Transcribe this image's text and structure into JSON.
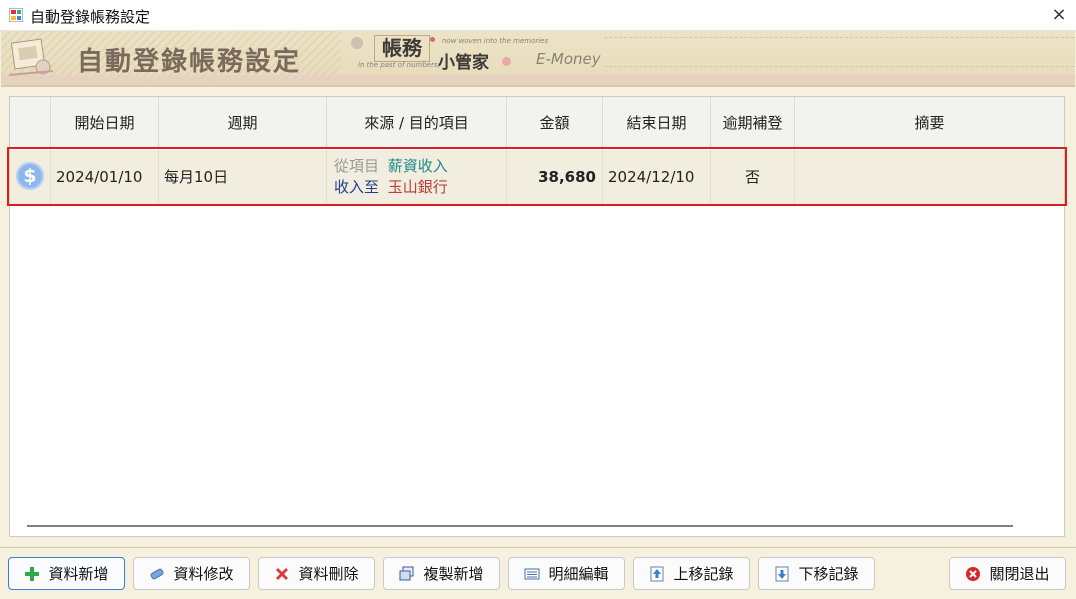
{
  "window": {
    "title": "自動登錄帳務設定",
    "close_glyph": "×"
  },
  "banner": {
    "title": "自動登錄帳務設定",
    "logo_text": "帳務",
    "tagline_top": "now woven into the memories",
    "tagline_bottom": "in the past of numbers,",
    "subtitle": "小管家",
    "brand": "E-Money"
  },
  "table": {
    "columns": [
      "開始日期",
      "週期",
      "來源 / 目的項目",
      "金額",
      "結束日期",
      "逾期補登",
      "摘要"
    ],
    "rows": [
      {
        "icon": "dollar-icon",
        "start_date": "2024/01/10",
        "period": "每月10日",
        "from_label": "從項目",
        "from_value": "薪資收入",
        "to_label": "收入至",
        "to_value": "玉山銀行",
        "amount": "38,680",
        "end_date": "2024/12/10",
        "overdue": "否",
        "summary": ""
      }
    ]
  },
  "colors": {
    "from_value": "#1f8a8a",
    "to_label": "#1f3f8a",
    "to_value": "#b84040",
    "highlight": "#d92020"
  },
  "buttons": {
    "add": "資料新增",
    "edit": "資料修改",
    "delete": "資料刪除",
    "copy_add": "複製新增",
    "detail_edit": "明細編輯",
    "move_up": "上移記錄",
    "move_down": "下移記錄",
    "close_exit": "關閉退出"
  }
}
